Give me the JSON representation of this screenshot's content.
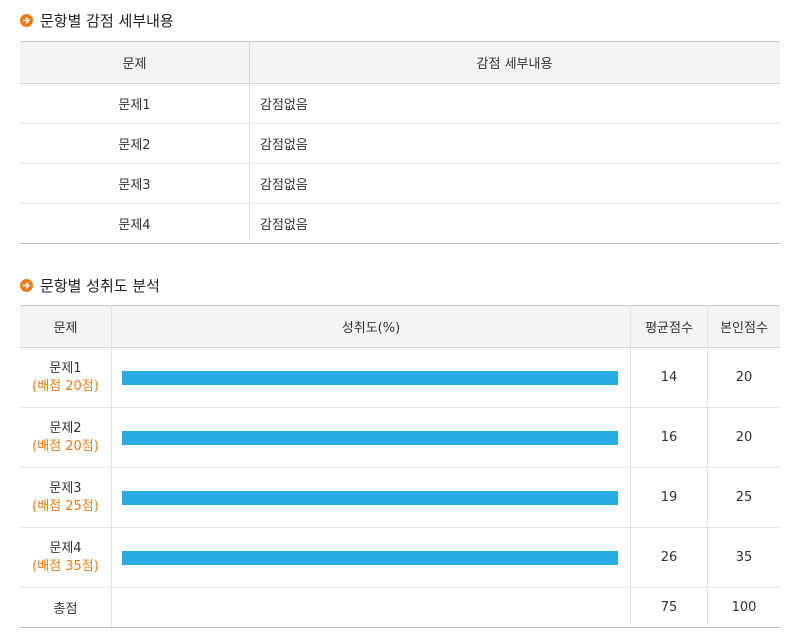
{
  "section1": {
    "title": "문항별 감점 세부내용",
    "headers": {
      "question": "문제",
      "detail": "감점 세부내용"
    },
    "rows": [
      {
        "question": "문제1",
        "detail": "감점없음"
      },
      {
        "question": "문제2",
        "detail": "감점없음"
      },
      {
        "question": "문제3",
        "detail": "감점없음"
      },
      {
        "question": "문제4",
        "detail": "감점없음"
      }
    ]
  },
  "section2": {
    "title": "문항별 성취도 분석",
    "headers": {
      "question": "문제",
      "achievement": "성취도(%)",
      "average": "평균점수",
      "mine": "본인점수"
    },
    "rows": [
      {
        "question": "문제1",
        "points": "(배점 20점)",
        "achievement_fraction": 1.0,
        "average": "14",
        "mine": "20"
      },
      {
        "question": "문제2",
        "points": "(배점 20점)",
        "achievement_fraction": 1.0,
        "average": "16",
        "mine": "20"
      },
      {
        "question": "문제3",
        "points": "(배점 25점)",
        "achievement_fraction": 1.0,
        "average": "19",
        "mine": "25"
      },
      {
        "question": "문제4",
        "points": "(배점 35점)",
        "achievement_fraction": 1.0,
        "average": "26",
        "mine": "35"
      }
    ],
    "total": {
      "label": "총점",
      "average": "75",
      "mine": "100"
    }
  },
  "colors": {
    "accent": "#f07b14",
    "bar": "#27abe2"
  },
  "icons": {
    "section_bullet": "arrow-right-circle-icon"
  }
}
